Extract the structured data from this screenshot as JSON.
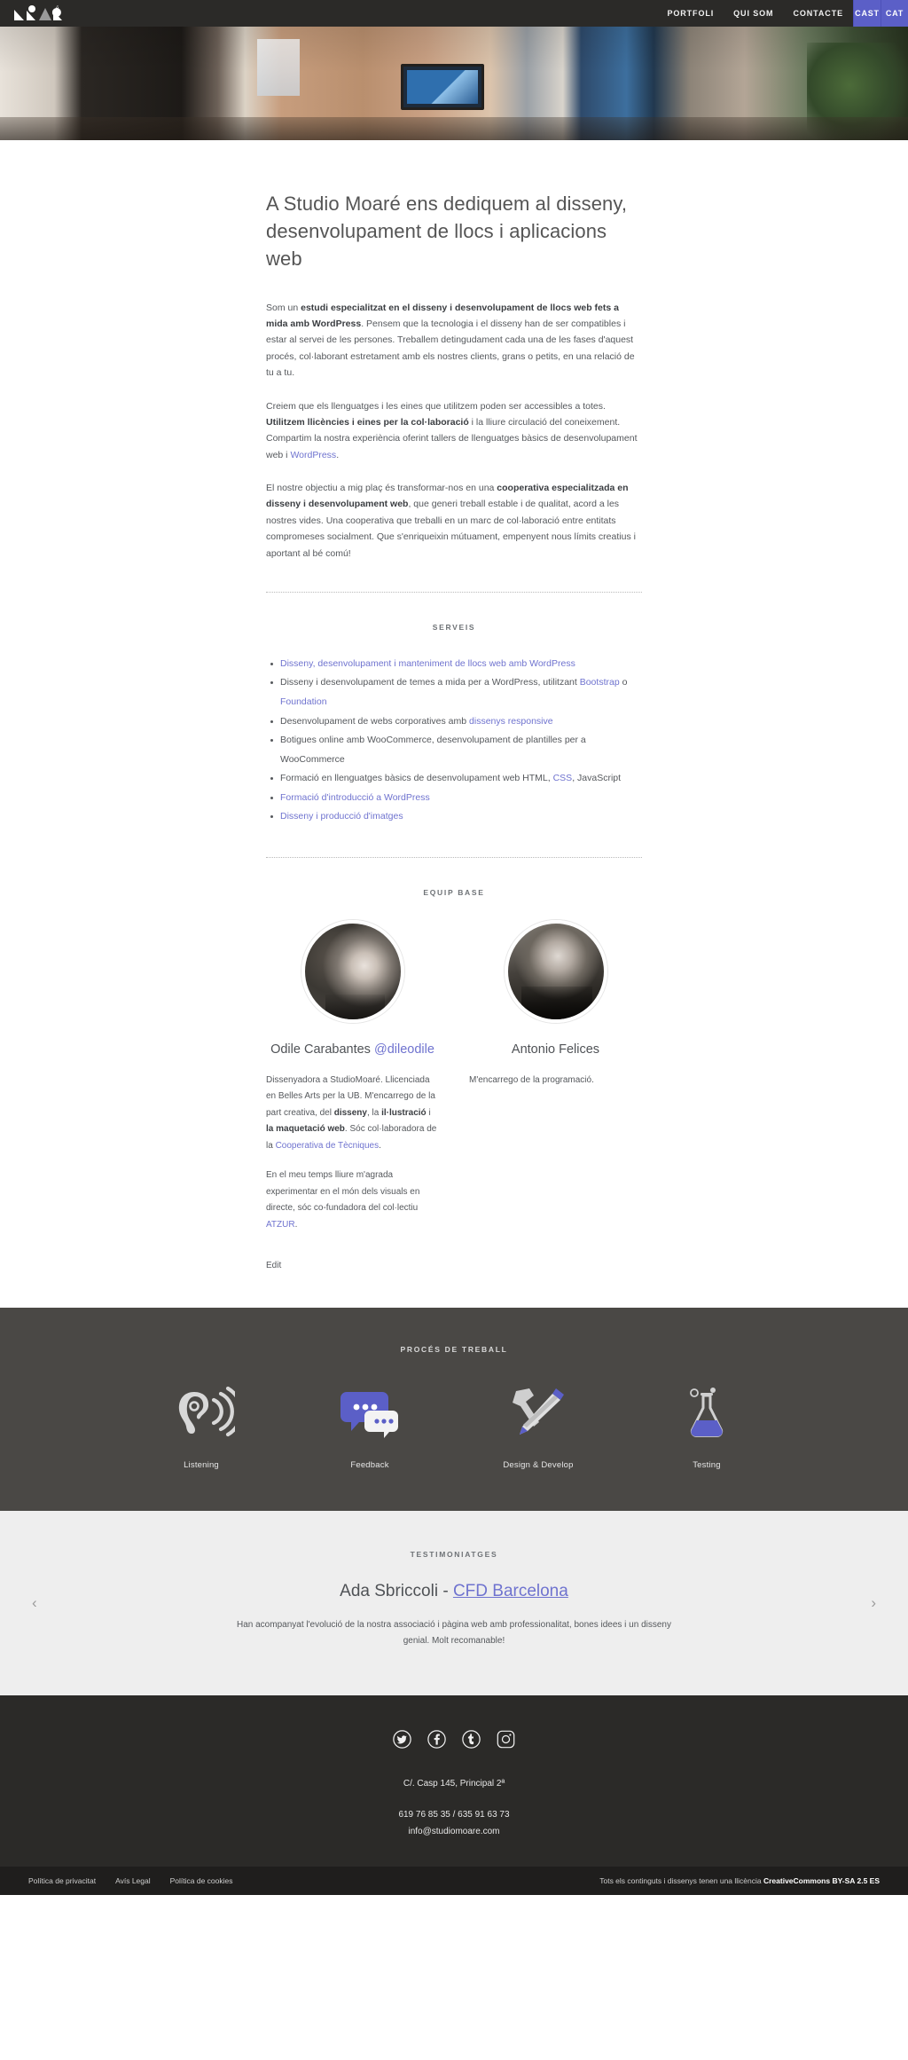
{
  "nav": {
    "logo_alt": "Studio Moaré",
    "links": [
      {
        "label": "PORTFOLI"
      },
      {
        "label": "QUI SOM"
      },
      {
        "label": "CONTACTE"
      }
    ],
    "languages": [
      {
        "label": "CAST"
      },
      {
        "label": "CAT"
      }
    ],
    "accent_color": "#5b5fc7",
    "bar_color": "#2b2a28"
  },
  "intro": {
    "title": "A Studio Moaré ens dediquem al disseny, desenvolupament de llocs i aplicacions web",
    "p1_a": "Som un ",
    "p1_b": "estudi especialitzat en el disseny i desenvolupament de llocs web fets a mida amb WordPress",
    "p1_c": ". Pensem que la tecnologia i el disseny han de ser compatibles i estar al servei de les persones. Treballem detingudament cada una de les fases d'aquest procés, col·laborant estretament amb els nostres clients, grans o petits, en una relació de tu a tu.",
    "p2_a": "Creiem que els llenguatges i les eines que utilitzem poden ser accessibles a totes. ",
    "p2_b": "Utilitzem llicències i eines per la col·laboració",
    "p2_c": " i la lliure circulació del coneixement. Compartim la nostra experiència oferint tallers de llenguatges bàsics de desenvolupament web i ",
    "p2_link": "WordPress",
    "p2_d": ".",
    "p3_a": "El nostre objectiu a mig plaç és transformar-nos en una ",
    "p3_b": "cooperativa especialitzada en disseny i desenvolupament web",
    "p3_c": ", que generi treball estable i de qualitat, acord a les nostres vides. Una cooperativa que treballi en un marc de col·laboració entre entitats compromeses socialment. Que s'enriqueixin mútuament, empenyent nous límits creatius i aportant al bé comú!"
  },
  "services": {
    "kicker": "SERVEIS",
    "items": [
      {
        "parts": [
          {
            "text": "Disseny, desenvolupament i manteniment de llocs web amb WordPress",
            "link": true
          }
        ]
      },
      {
        "parts": [
          {
            "text": "Disseny i desenvolupament de temes a mida per a WordPress, utilitzant ",
            "link": false
          },
          {
            "text": "Bootstrap",
            "link": true
          },
          {
            "text": " o ",
            "link": false
          },
          {
            "text": "Foundation",
            "link": true
          }
        ]
      },
      {
        "parts": [
          {
            "text": "Desenvolupament de webs corporatives amb ",
            "link": false
          },
          {
            "text": "dissenys responsive",
            "link": true
          }
        ]
      },
      {
        "parts": [
          {
            "text": "Botigues online amb WooCommerce, desenvolupament de plantilles per a WooCommerce",
            "link": false
          }
        ]
      },
      {
        "parts": [
          {
            "text": "Formació en llenguatges bàsics de desenvolupament web HTML, ",
            "link": false
          },
          {
            "text": "CSS",
            "link": true
          },
          {
            "text": ", JavaScript",
            "link": false
          }
        ]
      },
      {
        "parts": [
          {
            "text": "Formació d'introducció a WordPress",
            "link": true
          }
        ]
      },
      {
        "parts": [
          {
            "text": "Disseny i producció d'imatges",
            "link": true
          }
        ]
      }
    ]
  },
  "team": {
    "kicker": "EQUIP BASE",
    "members": [
      {
        "name": "Odile Carabantes",
        "handle": "@dileodile",
        "avatar": "odile-photo",
        "bio1_a": "Dissenyadora a StudioMoaré. Llicenciada en Belles Arts per la UB. M'encarrego de la part creativa, del ",
        "bio1_b1": "disseny",
        "bio1_c": ", la ",
        "bio1_b2": "il·lustració",
        "bio1_d": " i ",
        "bio1_b3": "la maquetació web",
        "bio1_e": ". Sóc col·laboradora de la ",
        "bio1_link": "Cooperativa de Tècniques",
        "bio1_f": ".",
        "bio2_a": "En el meu temps lliure m'agrada experimentar en el món dels visuals en directe, sóc co-fundadora del col·lectiu ",
        "bio2_link": "ATZUR",
        "bio2_b": "."
      },
      {
        "name": "Antonio Felices",
        "handle": "",
        "avatar": "antonio-photo",
        "bio1_a": "M'encarrego de la programació.",
        "bio1_b1": "",
        "bio1_c": "",
        "bio1_b2": "",
        "bio1_d": "",
        "bio1_b3": "",
        "bio1_e": "",
        "bio1_link": "",
        "bio1_f": "",
        "bio2_a": "",
        "bio2_link": "",
        "bio2_b": ""
      }
    ],
    "edit_label": "Edit"
  },
  "process": {
    "kicker": "PROCÉS DE TREBALL",
    "items": [
      {
        "label": "Listening",
        "icon": "ear-listening-icon"
      },
      {
        "label": "Feedback",
        "icon": "speech-bubbles-icon"
      },
      {
        "label": "Design & Develop",
        "icon": "hammer-pencil-icon"
      },
      {
        "label": "Testing",
        "icon": "flask-icon"
      }
    ],
    "background": "#4a4845",
    "accent": "#5b5fc7"
  },
  "testimonials": {
    "kicker": "TESTIMONIATGES",
    "author": "Ada Sbriccoli",
    "separator": " - ",
    "organisation": "CFD Barcelona",
    "quote": "Han acompanyat l'evolució de la nostra associació i pàgina web amb professionalitat, bones idees i un disseny genial. Molt recomanable!",
    "prev_label": "‹",
    "next_label": "›"
  },
  "footer": {
    "social": [
      {
        "name": "twitter-icon",
        "label": "Twitter"
      },
      {
        "name": "facebook-icon",
        "label": "Facebook"
      },
      {
        "name": "tumblr-icon",
        "label": "Tumblr"
      },
      {
        "name": "instagram-icon",
        "label": "Instagram"
      }
    ],
    "address": "C/. Casp 145, Principal 2ª",
    "phones": "619 76 85 35 / 635 91 63 73",
    "email": "info@studiomoare.com",
    "legal_links": [
      {
        "label": "Política de privacitat"
      },
      {
        "label": "Avís Legal"
      },
      {
        "label": "Política de cookies"
      }
    ],
    "copyright_a": "Tots els continguts i dissenys tenen una llicència ",
    "copyright_b": "CreativeCommons BY-SA 2.5 ES"
  }
}
